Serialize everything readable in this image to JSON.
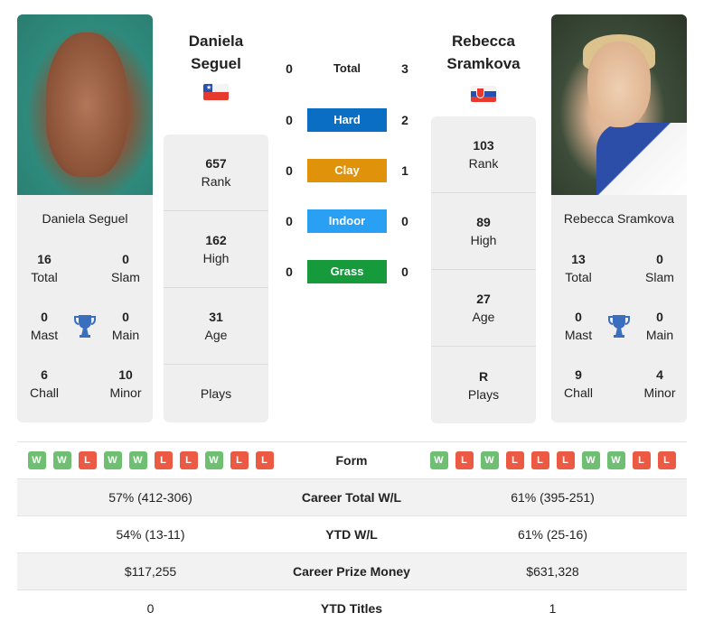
{
  "colors": {
    "hard": "#0a6fc2",
    "clay": "#e0920b",
    "indoor": "#2aa0f5",
    "grass": "#169a3c",
    "win": "#6fbf73",
    "loss": "#ec5a44",
    "trophy": "#3a6fbf"
  },
  "player1": {
    "name_line1": "Daniela",
    "name_line2": "Seguel",
    "full_name": "Daniela Seguel",
    "flag": "chile-flag",
    "titles": {
      "total": {
        "value": "16",
        "label": "Total"
      },
      "slam": {
        "value": "0",
        "label": "Slam"
      },
      "mast": {
        "value": "0",
        "label": "Mast"
      },
      "main": {
        "value": "0",
        "label": "Main"
      },
      "chall": {
        "value": "6",
        "label": "Chall"
      },
      "minor": {
        "value": "10",
        "label": "Minor"
      }
    },
    "rank": {
      "value": "657",
      "label": "Rank"
    },
    "high": {
      "value": "162",
      "label": "High"
    },
    "age": {
      "value": "31",
      "label": "Age"
    },
    "plays": {
      "value": "",
      "label": "Plays"
    },
    "form": [
      "W",
      "W",
      "L",
      "W",
      "W",
      "L",
      "L",
      "W",
      "L",
      "L"
    ]
  },
  "player2": {
    "name_line1": "Rebecca",
    "name_line2": "Sramkova",
    "full_name": "Rebecca Sramkova",
    "flag": "slovakia-flag",
    "titles": {
      "total": {
        "value": "13",
        "label": "Total"
      },
      "slam": {
        "value": "0",
        "label": "Slam"
      },
      "mast": {
        "value": "0",
        "label": "Mast"
      },
      "main": {
        "value": "0",
        "label": "Main"
      },
      "chall": {
        "value": "9",
        "label": "Chall"
      },
      "minor": {
        "value": "4",
        "label": "Minor"
      }
    },
    "rank": {
      "value": "103",
      "label": "Rank"
    },
    "high": {
      "value": "89",
      "label": "High"
    },
    "age": {
      "value": "27",
      "label": "Age"
    },
    "plays": {
      "value": "R",
      "label": "Plays"
    },
    "form": [
      "W",
      "L",
      "W",
      "L",
      "L",
      "L",
      "W",
      "W",
      "L",
      "L"
    ]
  },
  "h2h": {
    "total": {
      "label": "Total",
      "p1": "0",
      "p2": "3"
    },
    "surfaces": [
      {
        "label": "Hard",
        "p1": "0",
        "p2": "2",
        "color": "#0a6fc2"
      },
      {
        "label": "Clay",
        "p1": "0",
        "p2": "1",
        "color": "#e0920b"
      },
      {
        "label": "Indoor",
        "p1": "0",
        "p2": "0",
        "color": "#2aa0f5"
      },
      {
        "label": "Grass",
        "p1": "0",
        "p2": "0",
        "color": "#169a3c"
      }
    ]
  },
  "table": {
    "form_label": "Form",
    "rows": [
      {
        "label": "Career Total W/L",
        "p1": "57% (412-306)",
        "p2": "61% (395-251)"
      },
      {
        "label": "YTD W/L",
        "p1": "54% (13-11)",
        "p2": "61% (25-16)"
      },
      {
        "label": "Career Prize Money",
        "p1": "$117,255",
        "p2": "$631,328"
      },
      {
        "label": "YTD Titles",
        "p1": "0",
        "p2": "1"
      }
    ]
  }
}
